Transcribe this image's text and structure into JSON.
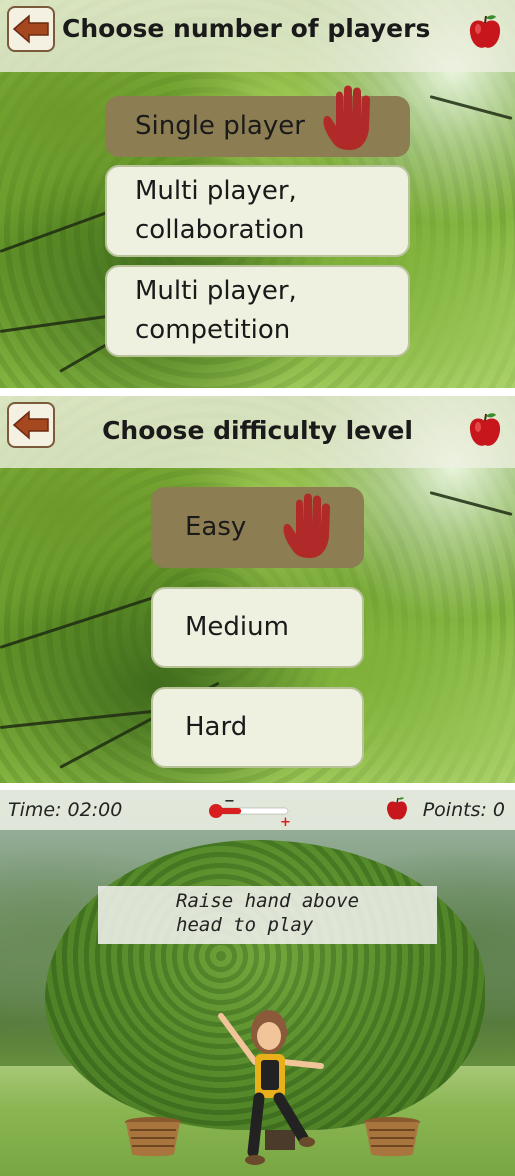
{
  "players_screen": {
    "title": "Choose number of players",
    "options": [
      {
        "line1": "Single player",
        "line2": "",
        "selected": true
      },
      {
        "line1": "Multi player,",
        "line2": "collaboration",
        "selected": false
      },
      {
        "line1": "Multi player,",
        "line2": "competition",
        "selected": false
      }
    ]
  },
  "difficulty_screen": {
    "title": "Choose difficulty level",
    "options": [
      {
        "label": "Easy",
        "selected": true
      },
      {
        "label": "Medium",
        "selected": false
      },
      {
        "label": "Hard",
        "selected": false
      }
    ]
  },
  "game_screen": {
    "time": "Time: 02:00",
    "points": "Points: 0",
    "slider_minus": "−",
    "slider_plus": "+",
    "slider_level": 0.4,
    "prompt_line1": "Raise hand above",
    "prompt_line2": "head to play"
  },
  "colors": {
    "selected_option": "#8c7d52",
    "option": "#eef0e0",
    "hand": "#b12a2a",
    "apple": "#c8161d",
    "back_arrow": "#a5471f"
  },
  "icons": [
    "back-arrow-icon",
    "apple-icon",
    "hand-icon",
    "basket-icon"
  ]
}
